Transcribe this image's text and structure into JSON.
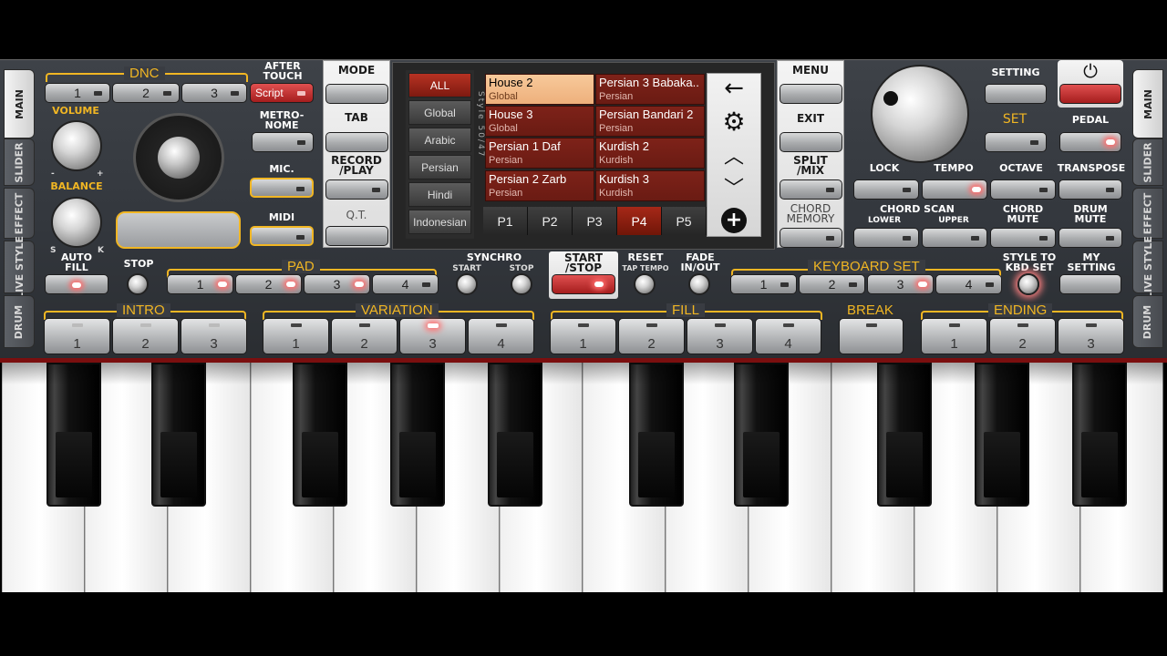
{
  "side_tabs_left": [
    "MAIN",
    "SLIDER",
    "EFFECT",
    "LIVE STYLE",
    "DRUM"
  ],
  "side_tabs_right": [
    "MAIN",
    "SLIDER",
    "EFFECT",
    "LIVE STYLE",
    "DRUM"
  ],
  "dnc": {
    "label": "DNC",
    "buttons": [
      "1",
      "2",
      "3"
    ],
    "script_label": "Script"
  },
  "after_touch": {
    "line1": "AFTER",
    "line2": "TOUCH"
  },
  "metronome": {
    "line1": "METRO-",
    "line2": "NOME"
  },
  "mic_label": "MIC.",
  "midi_label": "MIDI",
  "volume_label": "VOLUME",
  "balance_label": "BALANCE",
  "balance_marks": {
    "minus": "-",
    "plus": "+",
    "s": "S",
    "k": "K"
  },
  "auto_fill": {
    "line1": "AUTO",
    "line2": "FILL"
  },
  "stop_label": "STOP",
  "pad": {
    "label": "PAD",
    "buttons": [
      "1",
      "2",
      "3",
      "4"
    ]
  },
  "synchro": {
    "label": "SYNCHRO",
    "start": "START",
    "stop": "STOP"
  },
  "start_stop": {
    "line1": "START",
    "line2": "/STOP"
  },
  "reset": {
    "line1": "RESET",
    "line2": "TAP TEMPO"
  },
  "fade": {
    "line1": "FADE",
    "line2": "IN/OUT"
  },
  "keyboard_set": {
    "label": "KEYBOARD SET",
    "buttons": [
      "1",
      "2",
      "3",
      "4"
    ]
  },
  "style_to_kbd": {
    "line1": "STYLE TO",
    "line2": "KBD SET"
  },
  "my_setting": {
    "line1": "MY",
    "line2": "SETTING"
  },
  "intro": {
    "label": "INTRO",
    "buttons": [
      "1",
      "2",
      "3"
    ]
  },
  "variation": {
    "label": "VARIATION",
    "buttons": [
      "1",
      "2",
      "3",
      "4"
    ]
  },
  "fill": {
    "label": "FILL",
    "buttons": [
      "1",
      "2",
      "3",
      "4"
    ]
  },
  "break_label": "BREAK",
  "ending": {
    "label": "ENDING",
    "buttons": [
      "1",
      "2",
      "3"
    ]
  },
  "left_mid": {
    "mode": "MODE",
    "tab": "TAB",
    "record1": "RECORD",
    "record2": "/PLAY",
    "qt": "Q.T."
  },
  "right_mid": {
    "menu": "MENU",
    "exit": "EXIT",
    "split1": "SPLIT",
    "split2": "/MIX",
    "chord1": "CHORD",
    "chord2": "MEMORY"
  },
  "categories": [
    "ALL",
    "Global",
    "Arabic",
    "Persian",
    "Hindi",
    "Indonesian"
  ],
  "style_vertical": "Style 50/47",
  "styles": [
    {
      "name": "House 2",
      "cat": "Global"
    },
    {
      "name": "Persian 3 Babaka..",
      "cat": "Persian"
    },
    {
      "name": "House 3",
      "cat": "Global"
    },
    {
      "name": "Persian Bandari 2",
      "cat": "Persian"
    },
    {
      "name": "Persian 1 Daf",
      "cat": "Persian"
    },
    {
      "name": "Kurdish 2",
      "cat": "Kurdish"
    },
    {
      "name": "Persian 2 Zarb",
      "cat": "Persian"
    },
    {
      "name": "Kurdish 3",
      "cat": "Kurdish"
    }
  ],
  "pages": [
    "P1",
    "P2",
    "P3",
    "P4",
    "P5"
  ],
  "active_page": "P4",
  "nav_icons": [
    "back-arrow-icon",
    "gear-icon",
    "chevron-up-icon",
    "chevron-down-icon",
    "plus-icon"
  ],
  "nav_glyphs": {
    "back": "←",
    "gear": "⚙",
    "up": "︿",
    "down": "﹀",
    "plus": "+"
  },
  "right": {
    "setting": "SETTING",
    "power_glyph": "⏻",
    "set": "SET",
    "pedal": "PEDAL",
    "lock": "LOCK",
    "tempo": "TEMPO",
    "octave": "OCTAVE",
    "transpose": "TRANSPOSE",
    "chord_scan": "CHORD SCAN",
    "lower": "LOWER",
    "upper": "UPPER",
    "chord_mute1": "CHORD",
    "chord_mute2": "MUTE",
    "drum_mute1": "DRUM",
    "drum_mute2": "MUTE"
  },
  "colors": {
    "accent_gold": "#f1b623",
    "active_red": "#b83223",
    "selected_style": "#f7c99a",
    "led_glow": "#ff6b6b"
  }
}
